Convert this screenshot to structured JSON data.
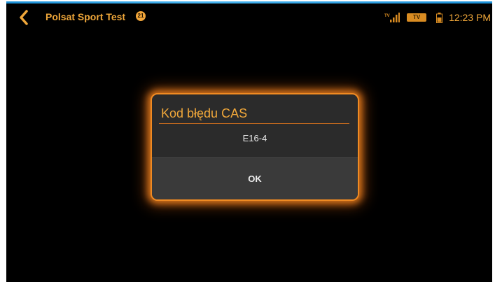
{
  "status_bar": {
    "channel_title": "Polsat Sport Test",
    "channel_badge": "21",
    "tv_badge": "TV",
    "clock": "12:23 PM"
  },
  "icons": {
    "back": "chevron-left-icon",
    "signal": "tv-signal-icon",
    "battery": "battery-icon"
  },
  "dialog": {
    "title": "Kod błędu CAS",
    "message": "E16-4",
    "ok_label": "OK"
  },
  "colors": {
    "accent": "#f0a73a",
    "glow": "#f08a22",
    "background": "#000000",
    "dialog": "#2b2b2b"
  }
}
